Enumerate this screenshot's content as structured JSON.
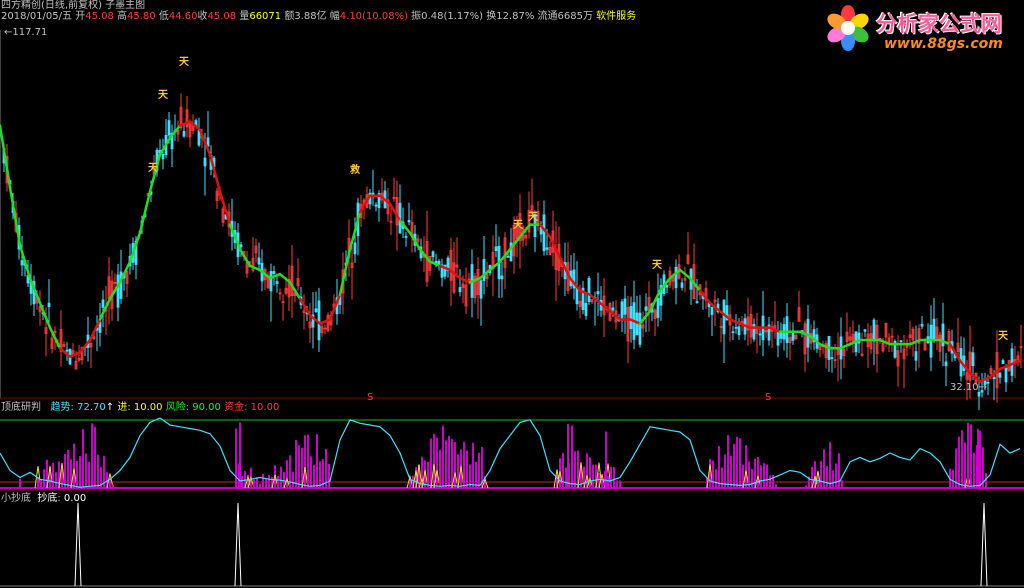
{
  "title_line": "四方精创(日线,前复权) 子墨主图",
  "info": {
    "date": "2018/01/05/五",
    "open_label": "开",
    "open": "45.08",
    "high_label": "高",
    "high": "45.80",
    "low_label": "低",
    "low": "44.60",
    "close_label": "收",
    "close": "45.08",
    "volume_label": "量",
    "volume": "66071",
    "amount_label": "额",
    "amount": "3.88亿",
    "amp_label": "幅",
    "amp": "4.10(10.08%)",
    "swing_label": "振",
    "swing": "0.48(1.17%)",
    "turnover_label": "换",
    "turnover": "12.87%",
    "float_label": "流通",
    "float": "6685万",
    "service": "软件服务"
  },
  "logo": {
    "name": "分析家公式网",
    "url": "www.88gs.com",
    "colors": [
      "#ff3b3b",
      "#ffd400",
      "#3cc03c",
      "#3b8cff",
      "#ff7ad9",
      "#ff9a2e"
    ]
  },
  "main_panel": {
    "high_label": "117.71",
    "low_label": "32.10",
    "signals": [
      "天",
      "天",
      "天",
      "救",
      "天",
      "天",
      "天",
      "天"
    ],
    "small_marks": [
      "S",
      "S"
    ]
  },
  "indicator_panel": {
    "name": "顶底研判",
    "labels": [
      {
        "key": "趋势",
        "value": "72.70",
        "arrow": "↑",
        "color": "#40e0ff"
      },
      {
        "key": "进",
        "value": "10.00",
        "color": "#ffff00"
      },
      {
        "key": "风险",
        "value": "90.00",
        "color": "#00ff00"
      },
      {
        "key": "资金",
        "value": "10.00",
        "color": "#ff3b3b"
      }
    ]
  },
  "bottom_panel": {
    "name": "小抄底",
    "label": "抄底",
    "value": "0.00"
  },
  "chart_data": {
    "type": "line",
    "price_range": [
      32.1,
      117.71
    ],
    "trend_line": [
      [
        0,
        95
      ],
      [
        10,
        80
      ],
      [
        20,
        66
      ],
      [
        30,
        58
      ],
      [
        40,
        52
      ],
      [
        50,
        46
      ],
      [
        60,
        41
      ],
      [
        70,
        39
      ],
      [
        80,
        40
      ],
      [
        90,
        43
      ],
      [
        100,
        48
      ],
      [
        110,
        53
      ],
      [
        120,
        57
      ],
      [
        130,
        62
      ],
      [
        140,
        69
      ],
      [
        150,
        79
      ],
      [
        160,
        88
      ],
      [
        170,
        92
      ],
      [
        180,
        95
      ],
      [
        190,
        96
      ],
      [
        200,
        94
      ],
      [
        210,
        88
      ],
      [
        220,
        79
      ],
      [
        230,
        71
      ],
      [
        240,
        65
      ],
      [
        250,
        61
      ],
      [
        260,
        60
      ],
      [
        270,
        58
      ],
      [
        280,
        59
      ],
      [
        290,
        57
      ],
      [
        300,
        53
      ],
      [
        310,
        49
      ],
      [
        320,
        47
      ],
      [
        330,
        48
      ],
      [
        340,
        54
      ],
      [
        350,
        65
      ],
      [
        360,
        74
      ],
      [
        370,
        78
      ],
      [
        380,
        78
      ],
      [
        390,
        76
      ],
      [
        400,
        72
      ],
      [
        410,
        69
      ],
      [
        420,
        65
      ],
      [
        430,
        62
      ],
      [
        440,
        61
      ],
      [
        450,
        60
      ],
      [
        460,
        58
      ],
      [
        470,
        57
      ],
      [
        480,
        58
      ],
      [
        490,
        60
      ],
      [
        500,
        62
      ],
      [
        510,
        65
      ],
      [
        520,
        68
      ],
      [
        530,
        71
      ],
      [
        540,
        71
      ],
      [
        550,
        68
      ],
      [
        560,
        63
      ],
      [
        570,
        58
      ],
      [
        580,
        55
      ],
      [
        590,
        54
      ],
      [
        600,
        52
      ],
      [
        610,
        50
      ],
      [
        620,
        48
      ],
      [
        630,
        48
      ],
      [
        640,
        47
      ],
      [
        650,
        50
      ],
      [
        660,
        55
      ],
      [
        670,
        58
      ],
      [
        680,
        60
      ],
      [
        690,
        58
      ],
      [
        700,
        55
      ],
      [
        710,
        52
      ],
      [
        720,
        50
      ],
      [
        730,
        48
      ],
      [
        740,
        47
      ],
      [
        750,
        46
      ],
      [
        760,
        46
      ],
      [
        770,
        46
      ],
      [
        780,
        45
      ],
      [
        790,
        45
      ],
      [
        800,
        45
      ],
      [
        810,
        44
      ],
      [
        820,
        42
      ],
      [
        830,
        41
      ],
      [
        840,
        41
      ],
      [
        850,
        42
      ],
      [
        860,
        43
      ],
      [
        870,
        43
      ],
      [
        880,
        43
      ],
      [
        890,
        42
      ],
      [
        900,
        42
      ],
      [
        910,
        42
      ],
      [
        920,
        43
      ],
      [
        930,
        43
      ],
      [
        940,
        43
      ],
      [
        950,
        42
      ],
      [
        960,
        38
      ],
      [
        970,
        35
      ],
      [
        980,
        33
      ],
      [
        990,
        34
      ],
      [
        1000,
        36
      ],
      [
        1010,
        37
      ],
      [
        1020,
        38
      ]
    ],
    "trend_down_segments": [
      [
        0,
        60
      ],
      [
        100,
        180
      ],
      [
        230,
        300
      ],
      [
        340,
        360
      ],
      [
        405,
        440
      ],
      [
        470,
        540
      ],
      [
        640,
        700
      ],
      [
        780,
        950
      ]
    ],
    "oscillator": [
      [
        0,
        40
      ],
      [
        10,
        20
      ],
      [
        20,
        12
      ],
      [
        30,
        18
      ],
      [
        40,
        10
      ],
      [
        50,
        8
      ],
      [
        60,
        5
      ],
      [
        70,
        3
      ],
      [
        80,
        1
      ],
      [
        90,
        2
      ],
      [
        100,
        3
      ],
      [
        110,
        10
      ],
      [
        120,
        20
      ],
      [
        130,
        35
      ],
      [
        140,
        60
      ],
      [
        150,
        75
      ],
      [
        160,
        80
      ],
      [
        170,
        72
      ],
      [
        180,
        70
      ],
      [
        190,
        68
      ],
      [
        200,
        66
      ],
      [
        210,
        62
      ],
      [
        220,
        48
      ],
      [
        230,
        20
      ],
      [
        240,
        8
      ],
      [
        250,
        10
      ],
      [
        260,
        12
      ],
      [
        270,
        10
      ],
      [
        280,
        9
      ],
      [
        290,
        7
      ],
      [
        300,
        4
      ],
      [
        310,
        2
      ],
      [
        320,
        3
      ],
      [
        330,
        8
      ],
      [
        340,
        55
      ],
      [
        350,
        78
      ],
      [
        360,
        74
      ],
      [
        370,
        72
      ],
      [
        380,
        70
      ],
      [
        390,
        60
      ],
      [
        400,
        40
      ],
      [
        410,
        10
      ],
      [
        420,
        5
      ],
      [
        430,
        3
      ],
      [
        440,
        2
      ],
      [
        450,
        3
      ],
      [
        460,
        2
      ],
      [
        470,
        4
      ],
      [
        480,
        3
      ],
      [
        490,
        20
      ],
      [
        500,
        45
      ],
      [
        510,
        60
      ],
      [
        520,
        75
      ],
      [
        530,
        78
      ],
      [
        540,
        60
      ],
      [
        550,
        20
      ],
      [
        560,
        8
      ],
      [
        570,
        5
      ],
      [
        580,
        4
      ],
      [
        590,
        8
      ],
      [
        600,
        10
      ],
      [
        610,
        8
      ],
      [
        620,
        12
      ],
      [
        630,
        30
      ],
      [
        640,
        50
      ],
      [
        650,
        70
      ],
      [
        660,
        68
      ],
      [
        670,
        66
      ],
      [
        680,
        64
      ],
      [
        690,
        55
      ],
      [
        700,
        20
      ],
      [
        710,
        8
      ],
      [
        720,
        5
      ],
      [
        730,
        4
      ],
      [
        740,
        3
      ],
      [
        750,
        4
      ],
      [
        760,
        8
      ],
      [
        770,
        10
      ],
      [
        780,
        15
      ],
      [
        790,
        20
      ],
      [
        800,
        18
      ],
      [
        810,
        10
      ],
      [
        820,
        8
      ],
      [
        830,
        5
      ],
      [
        840,
        8
      ],
      [
        850,
        30
      ],
      [
        860,
        35
      ],
      [
        870,
        30
      ],
      [
        880,
        34
      ],
      [
        890,
        40
      ],
      [
        900,
        35
      ],
      [
        910,
        32
      ],
      [
        920,
        45
      ],
      [
        930,
        40
      ],
      [
        940,
        30
      ],
      [
        950,
        10
      ],
      [
        960,
        4
      ],
      [
        970,
        2
      ],
      [
        980,
        3
      ],
      [
        990,
        15
      ],
      [
        1000,
        50
      ],
      [
        1010,
        40
      ],
      [
        1020,
        45
      ]
    ],
    "oscillator_range": [
      0,
      80
    ],
    "bottom_spikes_x": [
      78,
      238,
      984
    ]
  }
}
